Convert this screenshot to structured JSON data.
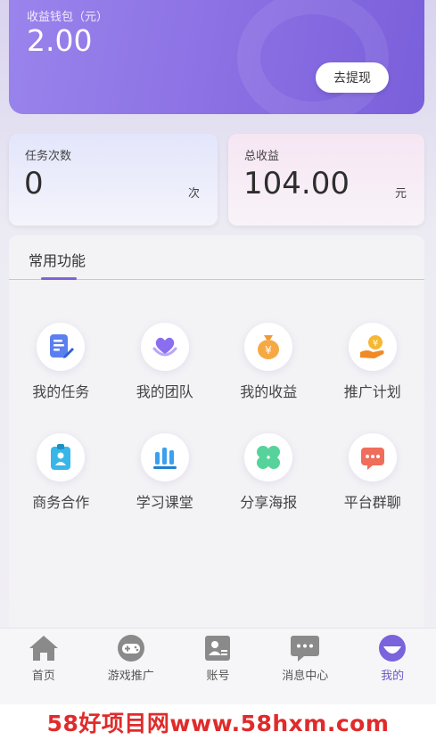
{
  "wallet": {
    "label": "收益钱包（元）",
    "amount": "2.00",
    "withdraw_label": "去提现"
  },
  "stats": {
    "tasks": {
      "title": "任务次数",
      "value": "0",
      "unit": "次"
    },
    "income": {
      "title": "总收益",
      "value": "104.00",
      "unit": "元"
    }
  },
  "functions": {
    "title": "常用功能",
    "items": [
      {
        "label": "我的任务",
        "icon": "task-icon",
        "color": "#5b7ff0"
      },
      {
        "label": "我的团队",
        "icon": "team-icon",
        "color": "#8b6ef0"
      },
      {
        "label": "我的收益",
        "icon": "money-bag-icon",
        "color": "#f6a943"
      },
      {
        "label": "推广计划",
        "icon": "promotion-icon",
        "color": "#f5a623"
      },
      {
        "label": "商务合作",
        "icon": "business-icon",
        "color": "#38b6e8"
      },
      {
        "label": "学习课堂",
        "icon": "classroom-icon",
        "color": "#3aa0ef"
      },
      {
        "label": "分享海报",
        "icon": "share-poster-icon",
        "color": "#56d39a"
      },
      {
        "label": "平台群聊",
        "icon": "group-chat-icon",
        "color": "#f06d5b"
      }
    ]
  },
  "nav": {
    "items": [
      {
        "label": "首页",
        "icon": "home-icon"
      },
      {
        "label": "游戏推广",
        "icon": "gamepad-icon"
      },
      {
        "label": "账号",
        "icon": "account-icon"
      },
      {
        "label": "消息中心",
        "icon": "message-icon"
      },
      {
        "label": "我的",
        "icon": "profile-icon",
        "active": true
      }
    ],
    "active_color": "#7a63dc",
    "inactive_color": "#8a8a8a"
  },
  "watermark": "58好项目网www.58hxm.com"
}
